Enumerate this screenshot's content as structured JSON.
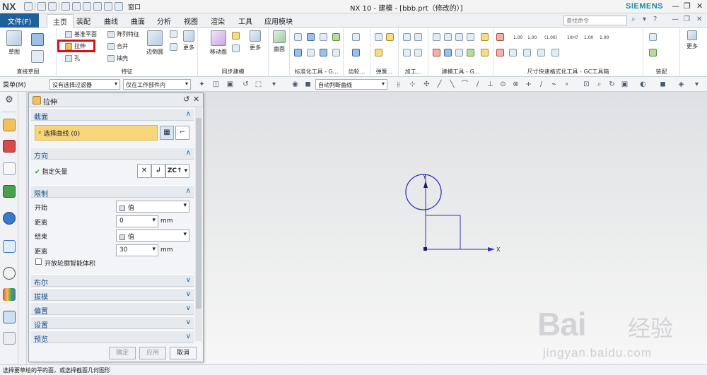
{
  "titlebar": {
    "logo": "NX",
    "window_menu": "窗口",
    "title": "NX 10 - 建模 - [bbb.prt（修改的）]",
    "brand": "SIEMENS"
  },
  "tabs": {
    "file": "文件(F)",
    "items": [
      "主页",
      "装配",
      "曲线",
      "曲面",
      "分析",
      "视图",
      "渲染",
      "工具",
      "应用模块"
    ],
    "active": "主页",
    "search_placeholder": "查找命令"
  },
  "ribbon": {
    "groups": {
      "direct_sketch": "直接草图",
      "feature": "特征",
      "sync_modeling": "同步建模",
      "standardize": "标准化工具 - G...",
      "gear": "齿轮...",
      "spring": "弹簧...",
      "machining": "加工...",
      "modeling_tools": "建模工具 - G...",
      "dim_quick_format": "尺寸快速格式化工具 - GC工具箱",
      "assembly": "装配"
    },
    "commands": {
      "sketch": "草图",
      "datum_plane": "基准平面",
      "array_feature": "阵列特征",
      "extrude": "拉伸",
      "combine": "合并",
      "hole": "孔",
      "shell": "抽壳",
      "edge_blend": "边倒圆",
      "more_feature": "更多",
      "move_face": "移动面",
      "more_sync": "更多",
      "surface": "曲面",
      "more_asm": "更多"
    },
    "dim_labels": [
      "1.00",
      "1.00",
      "(1.00)",
      "10H7",
      "1.00",
      "1.00"
    ]
  },
  "filterbar": {
    "menu": "菜单(M)",
    "filter": "没有选择过滤器",
    "scope": "仅在工作部件内",
    "curve_rule": "自动判断曲线"
  },
  "dialog": {
    "title": "拉伸",
    "sections": {
      "section": "截面",
      "direction": "方向",
      "limits": "限制",
      "boolean": "布尔",
      "draft": "拔模",
      "offset": "偏置",
      "settings": "设置",
      "preview": "预览"
    },
    "select_curve": "选择曲线 (0)",
    "specify_vector": "指定矢量",
    "vector_label": "ZC",
    "start_label": "开始",
    "start_value": "值",
    "start_distance_label": "距离",
    "start_distance": "0",
    "end_label": "结束",
    "end_value": "值",
    "end_distance_label": "距离",
    "end_distance": "30",
    "unit": "mm",
    "open_profile": "开放轮廓智能体积",
    "buttons": {
      "ok": "确定",
      "apply": "应用",
      "cancel": "取消"
    }
  },
  "graphics": {
    "x_axis": "X",
    "y_axis": "Y"
  },
  "status": "选择要草绘的平的面，或选择截面几何图形",
  "watermark": {
    "logo": "Bai",
    "cn": "经验",
    "url": "jingyan.baidu.com"
  },
  "colors": {
    "file_tab": "#1f5f9a",
    "highlight": "#d8101a",
    "sketch": "#3030c8",
    "select_row": "#f8d57a"
  }
}
